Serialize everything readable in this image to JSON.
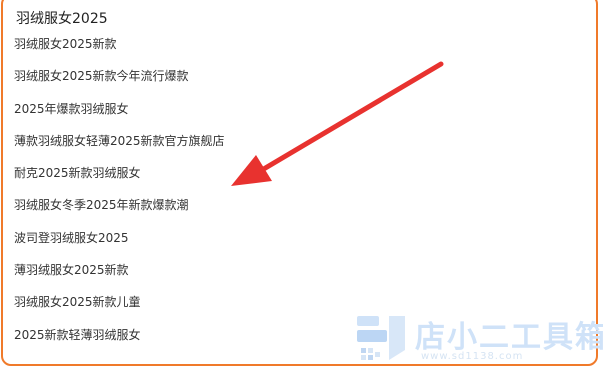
{
  "search": {
    "value": "羽绒服女2025"
  },
  "suggestions": [
    "羽绒服女2025新款",
    "羽绒服女2025新款今年流行爆款",
    "2025年爆款羽绒服女",
    "薄款羽绒服女轻薄2025新款官方旗舰店",
    "耐克2025新款羽绒服女",
    "羽绒服女冬季2025年新款爆款潮",
    "波司登羽绒服女2025",
    "薄羽绒服女2025新款",
    "羽绒服女2025新款儿童",
    "2025新款轻薄羽绒服女"
  ],
  "watermark": {
    "title": "店小二工具箱",
    "url": "www.sd1138.com"
  },
  "colors": {
    "border": "#f07a2a",
    "arrow": "#e8322f",
    "watermark": "#cfe2f8"
  }
}
